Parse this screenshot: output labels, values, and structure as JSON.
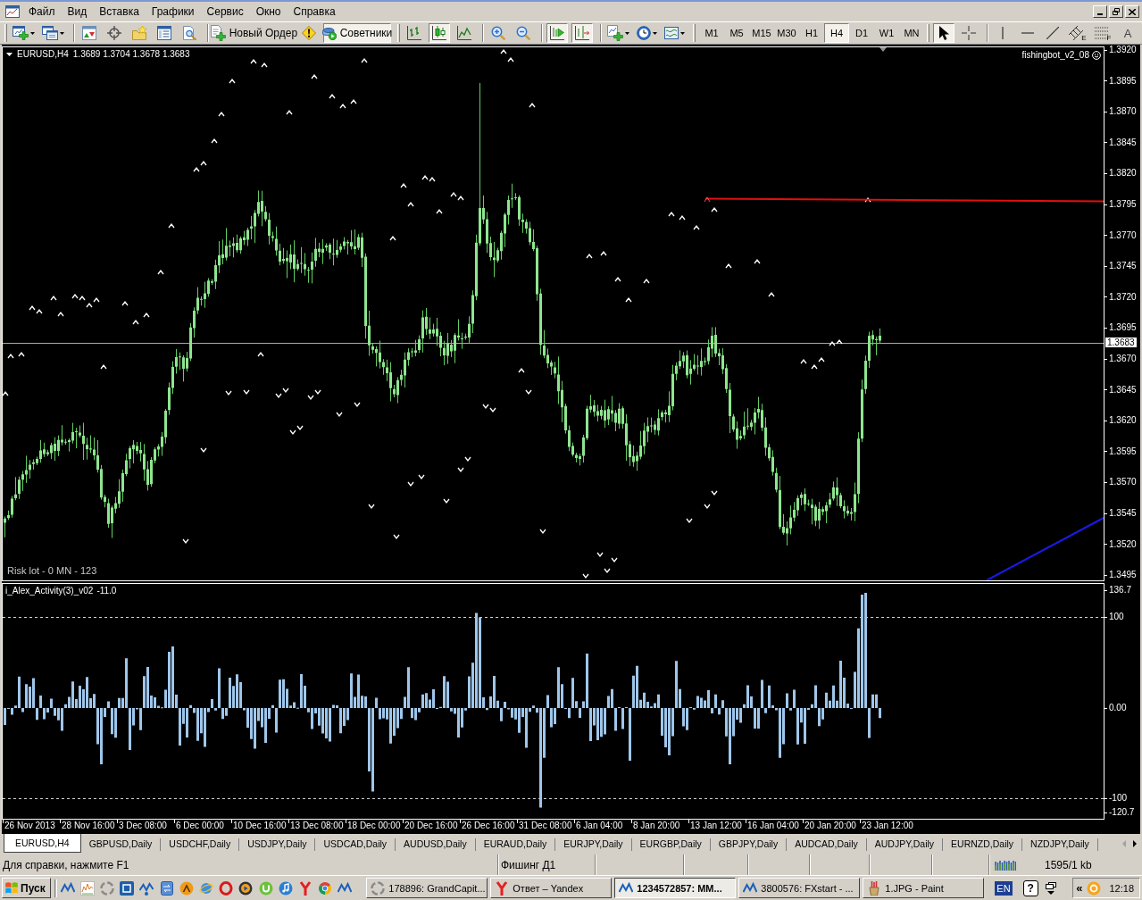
{
  "menu": [
    "Файл",
    "Вид",
    "Вставка",
    "Графики",
    "Сервис",
    "Окно",
    "Справка"
  ],
  "toolbar": {
    "new_order": "Новый Ордер",
    "experts": {
      "label": "Советники",
      "on": true
    },
    "chart_types": [
      {
        "selected": false
      },
      {
        "selected": true
      },
      {
        "selected": false
      }
    ],
    "auto_scroll": {
      "on": true
    },
    "chart_shift": {
      "on": true
    },
    "periods": [
      {
        "label": "M1",
        "selected": false
      },
      {
        "label": "M5",
        "selected": false
      },
      {
        "label": "M15",
        "selected": false
      },
      {
        "label": "M30",
        "selected": false
      },
      {
        "label": "H1",
        "selected": false
      },
      {
        "label": "H4",
        "selected": true
      },
      {
        "label": "D1",
        "selected": false
      },
      {
        "label": "W1",
        "selected": false
      },
      {
        "label": "MN",
        "selected": false
      }
    ],
    "cursor_modes": [
      {
        "selected": true
      },
      {
        "selected": false
      }
    ],
    "equidistant_channel": "E",
    "fibonacci": "F",
    "text_tool": "A"
  },
  "chart": {
    "symbol": "EURUSD,H4",
    "quote": "1.3689 1.3704 1.3678 1.3683",
    "expert": "fishingbot_v2_08",
    "expert_enabled": true,
    "comment": "Risk lot - 0 MN - 123",
    "price_axis": [
      "1.3920",
      "1.3895",
      "1.3870",
      "1.3845",
      "1.3820",
      "1.3795",
      "1.3770",
      "1.3745",
      "1.3720",
      "1.3695",
      "1.3670",
      "1.3645",
      "1.3620",
      "1.3595",
      "1.3570",
      "1.3545",
      "1.3520",
      "1.3495"
    ],
    "current_price": "1.3683"
  },
  "indicator": {
    "name": "i_Alex_Activity(3)_v02",
    "value": "-11.0",
    "axis": [
      "136.7",
      "100",
      "0.00",
      "-100",
      "-120.7"
    ]
  },
  "time_axis": [
    "26 Nov 2013",
    "28 Nov 16:00",
    "3 Dec 08:00",
    "6 Dec 00:00",
    "10 Dec 16:00",
    "13 Dec 08:00",
    "18 Dec 00:00",
    "20 Dec 16:00",
    "26 Dec 16:00",
    "31 Dec 08:00",
    "6 Jan 04:00",
    "8 Jan 20:00",
    "13 Jan 12:00",
    "16 Jan 04:00",
    "20 Jan 20:00",
    "23 Jan 12:00"
  ],
  "tabs": [
    {
      "label": "EURUSD,H4",
      "selected": true
    },
    {
      "label": "GBPUSD,Daily",
      "selected": false
    },
    {
      "label": "USDCHF,Daily",
      "selected": false
    },
    {
      "label": "USDJPY,Daily",
      "selected": false
    },
    {
      "label": "USDCAD,Daily",
      "selected": false
    },
    {
      "label": "AUDUSD,Daily",
      "selected": false
    },
    {
      "label": "EURAUD,Daily",
      "selected": false
    },
    {
      "label": "EURJPY,Daily",
      "selected": false
    },
    {
      "label": "EURGBP,Daily",
      "selected": false
    },
    {
      "label": "GBPJPY,Daily",
      "selected": false
    },
    {
      "label": "AUDCAD,Daily",
      "selected": false
    },
    {
      "label": "AUDJPY,Daily",
      "selected": false
    },
    {
      "label": "EURNZD,Daily",
      "selected": false
    },
    {
      "label": "NZDJPY,Daily",
      "selected": false
    }
  ],
  "tab_scroll": [
    {
      "disabled": true
    },
    {
      "disabled": false
    }
  ],
  "status_bar": {
    "help": "Для справки, нажмите F1",
    "profile": "Фишинг Д1",
    "traffic": "1595/1 kb"
  },
  "taskbar": {
    "start": "Пуск",
    "windows": [
      {
        "label": "178896: GrandCapit...",
        "selected": false
      },
      {
        "label": "Ответ – Yandex",
        "selected": false
      },
      {
        "label": "1234572857: MM...",
        "selected": true
      },
      {
        "label": "3800576: FXstart - ...",
        "selected": false
      },
      {
        "label": "1.JPG - Paint",
        "selected": false
      }
    ],
    "language": "EN",
    "help": "?",
    "tray_toggle": "«",
    "clock": "12:18"
  }
}
